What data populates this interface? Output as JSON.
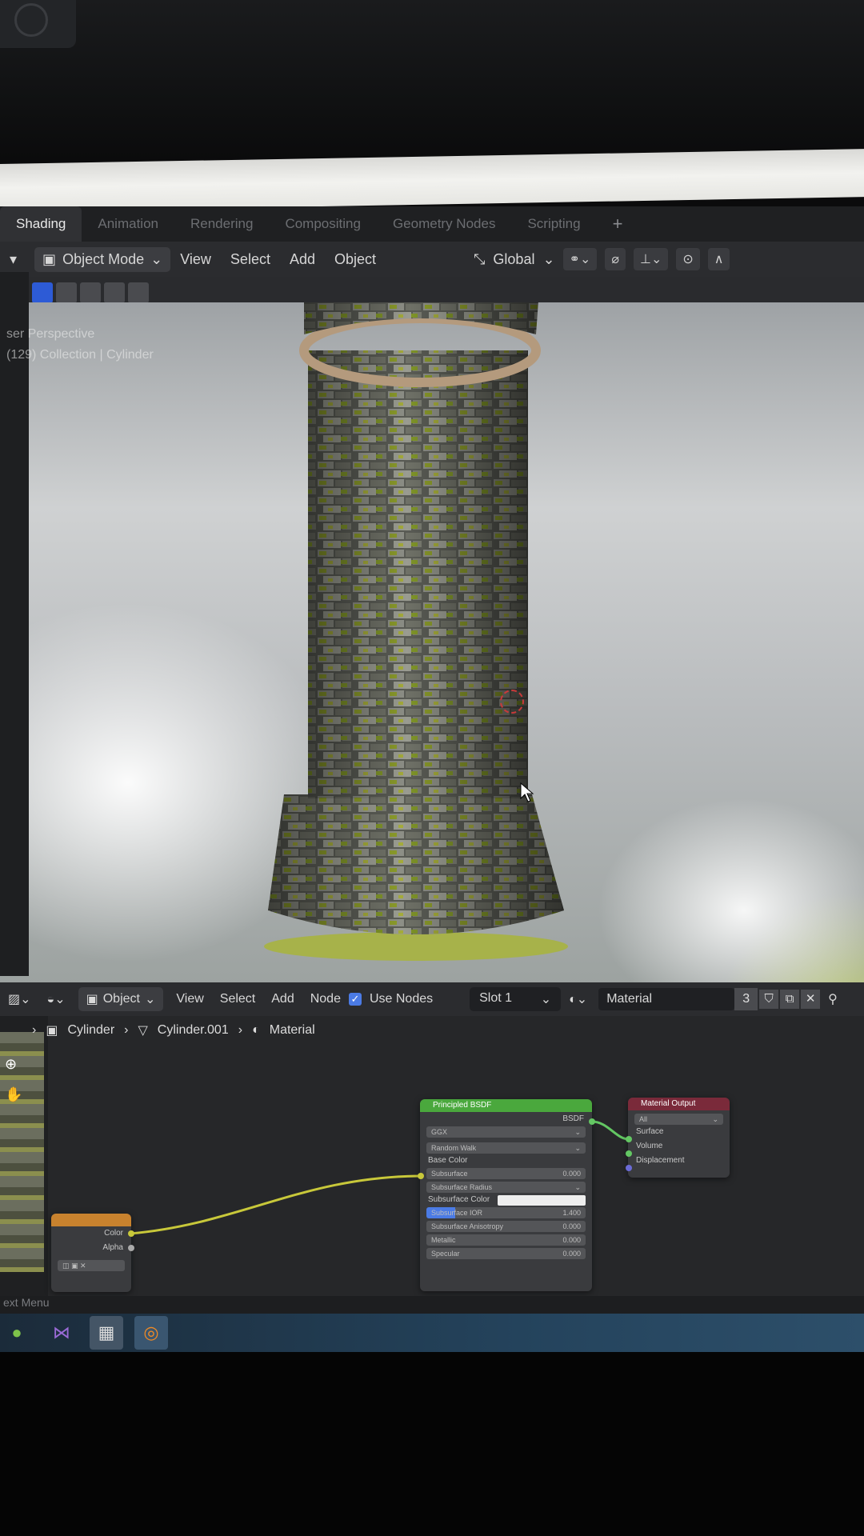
{
  "workspace_tabs": [
    "Shading",
    "Animation",
    "Rendering",
    "Compositing",
    "Geometry Nodes",
    "Scripting",
    "+"
  ],
  "viewport_header": {
    "mode": "Object Mode",
    "menus": [
      "View",
      "Select",
      "Add",
      "Object"
    ],
    "transform_orientation": "Global"
  },
  "viewport_overlay": {
    "line1": "ser Perspective",
    "line2": "(129) Collection | Cylinder"
  },
  "node_header": {
    "mode": "Object",
    "menus": [
      "View",
      "Select",
      "Add",
      "Node"
    ],
    "use_nodes_label": "Use Nodes",
    "slot": "Slot 1",
    "material": "Material",
    "users": "3"
  },
  "breadcrumb": {
    "object": "Cylinder",
    "mesh": "Cylinder.001",
    "material": "Material"
  },
  "principled_node": {
    "title": "Principled BSDF",
    "output": "BSDF",
    "distribution": "GGX",
    "subsurface_method": "Random Walk",
    "rows": [
      {
        "label": "Base Color",
        "value": ""
      },
      {
        "label": "Subsurface",
        "value": "0.000"
      },
      {
        "label": "Subsurface Radius",
        "value": ""
      },
      {
        "label": "Subsurface Color",
        "value": ""
      },
      {
        "label": "Subsurface IOR",
        "value": "1.400"
      },
      {
        "label": "Subsurface Anisotropy",
        "value": "0.000"
      },
      {
        "label": "Metallic",
        "value": "0.000"
      },
      {
        "label": "Specular",
        "value": "0.000"
      }
    ]
  },
  "output_node": {
    "title": "Material Output",
    "target": "All",
    "inputs": [
      "Surface",
      "Volume",
      "Displacement"
    ]
  },
  "texture_node": {
    "outputs": [
      "Color",
      "Alpha"
    ]
  },
  "status_text": "ext Menu",
  "colors": {
    "principled_header": "#4aa83d",
    "output_header": "#7a2a3a",
    "texture_header": "#c8822e",
    "link_yellow": "#c8c83a",
    "link_green": "#63c763"
  }
}
